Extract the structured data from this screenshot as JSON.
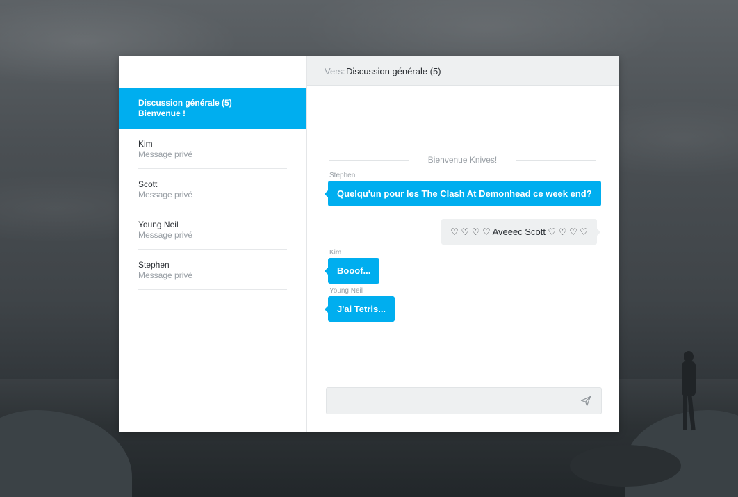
{
  "sidebar": {
    "channels": [
      {
        "name": "Discussion générale (5)",
        "subtitle": "Bienvenue !",
        "active": true
      },
      {
        "name": "Kim",
        "subtitle": "Message privé",
        "active": false
      },
      {
        "name": "Scott",
        "subtitle": "Message privé",
        "active": false
      },
      {
        "name": "Young Neil",
        "subtitle": "Message privé",
        "active": false
      },
      {
        "name": "Stephen",
        "subtitle": "Message privé",
        "active": false
      }
    ]
  },
  "header": {
    "to_label": "Vers:",
    "to_value": "Discussion générale (5)"
  },
  "messages": {
    "welcome": "Bienvenue Knives!",
    "items": [
      {
        "author": "Stephen",
        "text": "Quelqu'un pour les The Clash At Demonhead ce week end?",
        "direction": "in"
      },
      {
        "author": "",
        "text": "♡ ♡ ♡ ♡ Aveeec Scott ♡ ♡ ♡ ♡",
        "direction": "out"
      },
      {
        "author": "Kim",
        "text": "Booof...",
        "direction": "in"
      },
      {
        "author": "Young Neil",
        "text": "J'ai Tetris...",
        "direction": "in"
      }
    ]
  },
  "composer": {
    "value": "",
    "placeholder": "",
    "send_icon": "paper-plane-icon"
  },
  "colors": {
    "accent": "#00aeef",
    "panel_gray": "#eef0f1",
    "text_dark": "#2c3035",
    "text_muted": "#9aa0a6"
  }
}
